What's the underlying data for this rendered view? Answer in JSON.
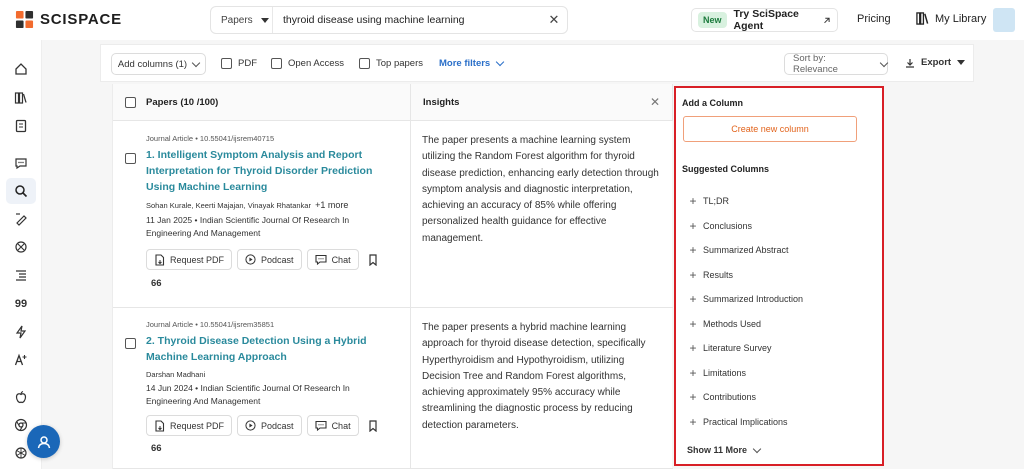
{
  "header": {
    "logo_text": "SCISPACE",
    "search_category": "Papers",
    "search_query": "thyroid disease using machine learning",
    "new_badge": "New",
    "agent_label": "Try SciSpace Agent",
    "pricing": "Pricing",
    "library": "My Library"
  },
  "rail": {
    "items": [
      "home-icon",
      "library-books-icon",
      "notebook-icon",
      "chat-icon",
      "search-icon",
      "pen-icon",
      "ai-detector-icon",
      "outline-icon",
      "citation-icon",
      "bolt-icon",
      "paraphrase-icon",
      "apple-icon",
      "chrome-icon",
      "openai-icon"
    ],
    "quote_glyph": "99"
  },
  "toolbar": {
    "add_columns": "Add columns (1)",
    "pdf": "PDF",
    "open_access": "Open Access",
    "top_papers": "Top papers",
    "more_filters": "More filters",
    "sort": "Sort by: Relevance",
    "export": "Export"
  },
  "table": {
    "papers_header": "Papers (10 /100)",
    "insights_header": "Insights",
    "rows": [
      {
        "meta": "Journal Article • 10.55041/ijsrem40715",
        "title": "1. Intelligent Symptom Analysis and Report Interpretation for Thyroid Disorder Prediction Using Machine Learning",
        "authors": "Sohan Kurale, Keerti Majajan, Vinayak Rhatankar",
        "authors_more": "+1 more",
        "pubinfo": "11 Jan 2025 • Indian Scientific Journal Of Research In Engineering And Management",
        "citations": "66",
        "insight": "The paper presents a machine learning system utilizing the Random Forest algorithm for thyroid disease prediction, enhancing early detection through symptom analysis and diagnostic interpretation, achieving an accuracy of 85% while offering personalized health guidance for effective management."
      },
      {
        "meta": "Journal Article • 10.55041/ijsrem35851",
        "title": "2. Thyroid Disease Detection Using a Hybrid Machine Learning Approach",
        "authors": "Darshan Madhani",
        "authors_more": "",
        "pubinfo": "14 Jun 2024 • Indian Scientific Journal Of Research In Engineering And Management",
        "citations": "66",
        "insight": "The paper presents a hybrid machine learning approach for thyroid disease detection, specifically Hyperthyroidism and Hypothyroidism, utilizing Decision Tree and Random Forest algorithms, achieving approximately 95% accuracy while streamlining the diagnostic process by reducing detection parameters."
      }
    ],
    "actions": {
      "request_pdf": "Request PDF",
      "podcast": "Podcast",
      "chat": "Chat"
    }
  },
  "panel": {
    "title": "Add a Column",
    "create": "Create new column",
    "suggested_title": "Suggested Columns",
    "suggested": [
      "TL;DR",
      "Conclusions",
      "Summarized Abstract",
      "Results",
      "Summarized Introduction",
      "Methods Used",
      "Literature Survey",
      "Limitations",
      "Contributions",
      "Practical Implications"
    ],
    "show_more": "Show 11 More"
  },
  "colors": {
    "brand_orange": "#e2641d",
    "title_teal": "#2a8a9c",
    "link_blue": "#2a6fc9",
    "highlight_red": "#d81f26",
    "fab_blue": "#1a67b8"
  }
}
